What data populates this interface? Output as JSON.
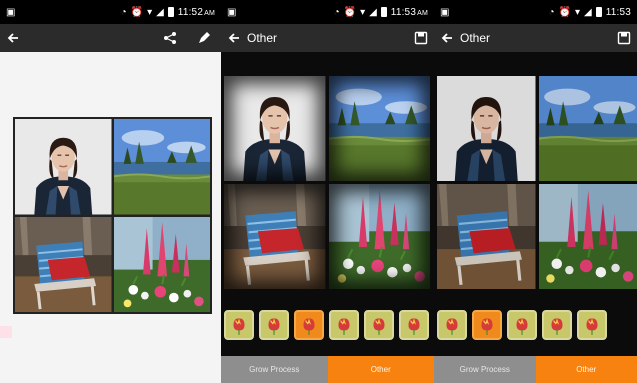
{
  "status": {
    "time_1": "11:52",
    "ampm_1": "AM",
    "time_2": "11:53",
    "ampm_2": "AM",
    "time_3": "11:53"
  },
  "panel1": {
    "toolbar": {
      "back_icon": "arrow-left-icon",
      "share_icon": "share-icon",
      "edit_icon": "pencil-icon"
    }
  },
  "panel2": {
    "toolbar": {
      "title": "Other",
      "back_icon": "arrow-left-icon",
      "save_icon": "save-icon"
    },
    "filters": [
      "Grow Process",
      "Other"
    ],
    "active_filter": "Other"
  },
  "panel3": {
    "toolbar": {
      "title": "Other",
      "back_icon": "arrow-left-icon",
      "save_icon": "save-icon"
    },
    "filters": [
      "Grow Process",
      "Other"
    ],
    "active_filter": "Other"
  },
  "colors": {
    "toolbar_bg": "#2b2b2b",
    "accent_orange": "#f7820f",
    "inactive_tab": "#8e8e8e",
    "thumb_bg": "#c8c86a"
  }
}
